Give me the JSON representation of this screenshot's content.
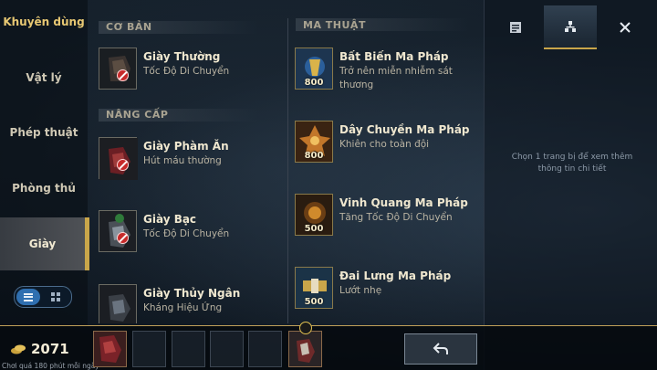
{
  "sidebar": {
    "categories": [
      {
        "label": "Khuyên dùng"
      },
      {
        "label": "Vật lý"
      },
      {
        "label": "Phép thuật"
      },
      {
        "label": "Phòng thủ"
      },
      {
        "label": "Giày"
      }
    ]
  },
  "sections": {
    "co_ban": "CƠ BẢN",
    "nang_cap": "NÂNG CẤP",
    "ma_thuat": "MA THUẬT"
  },
  "items": {
    "giay_thuong": {
      "name": "Giày Thường",
      "desc": "Tốc Độ Di Chuyển"
    },
    "giay_pham_an": {
      "name": "Giày Phàm Ăn",
      "desc": "Hút máu thường"
    },
    "giay_bac": {
      "name": "Giày Bạc",
      "desc": "Tốc Độ Di Chuyển"
    },
    "giay_thuy_ngan": {
      "name": "Giày Thủy Ngân",
      "desc": "Kháng Hiệu Ứng"
    },
    "bat_bien": {
      "name": "Bất Biến Ma Pháp",
      "desc": "Trở nên miễn nhiễm sát thương",
      "price": "800"
    },
    "day_chuyen": {
      "name": "Dây Chuyền Ma Pháp",
      "desc": "Khiên cho toàn đội",
      "price": "800"
    },
    "vinh_quang": {
      "name": "Vinh Quang Ma Pháp",
      "desc": "Tăng Tốc Độ Di Chuyển",
      "price": "500"
    },
    "dai_lung": {
      "name": "Đai Lưng Ma Pháp",
      "desc": "Lướt nhẹ",
      "price": "500"
    }
  },
  "right_panel": {
    "hint": "Chọn 1 trang bị để xem thêm thông tin chi tiết"
  },
  "bottom": {
    "gold": "2071",
    "tip": "Chơi quá 180 phút mỗi ngày"
  },
  "colors": {
    "accent": "#c9a64a",
    "selected_toggle": "#2f6fb0"
  }
}
